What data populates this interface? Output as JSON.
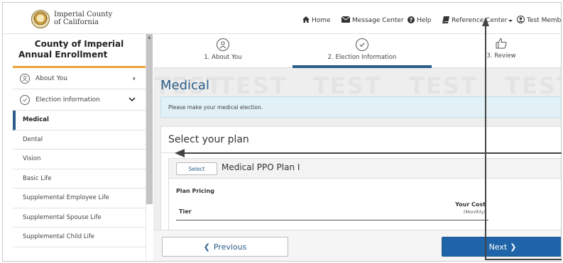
{
  "header": {
    "org_line1": "Imperial County",
    "org_line2": "of California",
    "nav": {
      "home": "Home",
      "message_center": "Message Center",
      "help": "Help",
      "reference_center": "Reference Center",
      "user": "Test Member"
    }
  },
  "sidebar": {
    "title_line1": "County of Imperial",
    "title_line2": "Annual Enrollment",
    "sections": [
      {
        "label": "About You",
        "chevron": "›"
      },
      {
        "label": "Election Information",
        "chevron": "⌄"
      }
    ],
    "items": [
      {
        "label": "Medical",
        "active": true
      },
      {
        "label": "Dental"
      },
      {
        "label": "Vision"
      },
      {
        "label": "Basic Life"
      },
      {
        "label": "Supplemental Employee Life"
      },
      {
        "label": "Supplemental Spouse Life"
      },
      {
        "label": "Supplemental Child Life"
      }
    ]
  },
  "steps": [
    {
      "label": "1. About You",
      "icon": "person-circle-icon"
    },
    {
      "label": "2. Election Information",
      "icon": "check-circle-icon",
      "active": true
    },
    {
      "label": "3. Review",
      "icon": "thumbs-up-icon"
    }
  ],
  "main": {
    "watermark": "TEST",
    "heading": "Medical",
    "info": "Please make your medical election.",
    "select_heading": "Select your plan",
    "plan": {
      "select_label": "Select",
      "name": "Medical PPO Plan I",
      "pricing_label": "Plan Pricing",
      "cost_label": "Your Cost",
      "cost_period": "(Monthly)",
      "tier_label": "Tier"
    }
  },
  "footer": {
    "previous_label": "Previous",
    "next_label": "Next"
  },
  "colors": {
    "brand_blue": "#2b5d8a",
    "next_button": "#1f63a8",
    "accent_orange": "#e9a23b",
    "info_bg": "#e1f1f6"
  }
}
